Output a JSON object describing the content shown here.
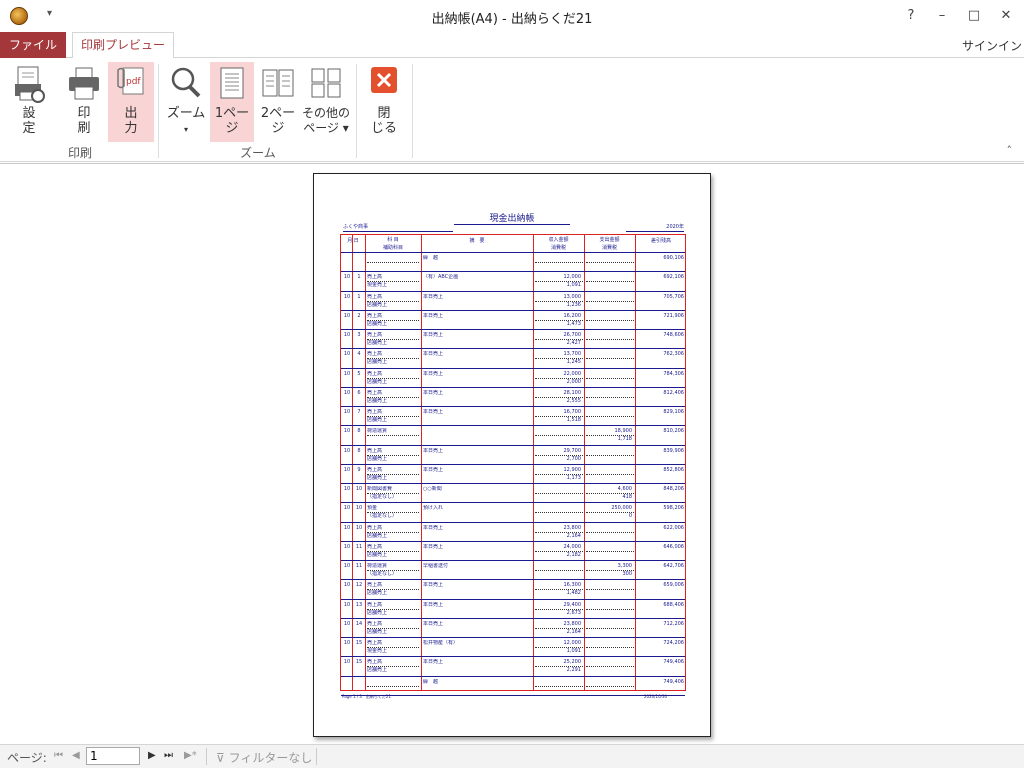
{
  "window": {
    "title": "出納帳(A4) - 出納らくだ21",
    "help": "?",
    "minimize": "–",
    "maximize": "□",
    "close": "✕",
    "qat": "▾"
  },
  "tabs": {
    "file": "ファイル",
    "print_preview": "印刷プレビュー",
    "signin": "サインイン"
  },
  "ribbon": {
    "settings": [
      "設",
      "定"
    ],
    "print": [
      "印",
      "刷"
    ],
    "output": [
      "出",
      "力"
    ],
    "zoom": [
      "ズーム",
      "▾"
    ],
    "one_page": [
      "1ペー",
      "ジ"
    ],
    "two_page": [
      "2ペー",
      "ジ"
    ],
    "other_pages": [
      "その他の",
      "ページ ▾"
    ],
    "close": [
      "閉",
      "じる"
    ],
    "group_print": "印刷",
    "group_zoom": "ズーム",
    "collapse": "˄",
    "accent": "#a4373a",
    "active_bg": "#f9d4d4"
  },
  "report": {
    "title": "現金出納帳",
    "company": "ふくや商事",
    "year": "2020年",
    "headers": {
      "date": "月 日",
      "account": "科 目",
      "sub_account": "補助科目",
      "description": "摘　要",
      "income": "収入金額",
      "income_tax": "消費税",
      "expense": "支出金額",
      "expense_tax": "消費税",
      "balance": "差引残高"
    },
    "rows": [
      {
        "m": "",
        "d": "",
        "a": "",
        "s": "",
        "desc": "繰　越",
        "inc": "",
        "inct": "",
        "exp": "",
        "expt": "",
        "bal": "690,106"
      },
      {
        "m": "10",
        "d": "1",
        "a": "売上高",
        "s": "現金売上",
        "desc": "（有）ABC企画",
        "inc": "12,000",
        "inct": "1,091",
        "exp": "",
        "expt": "",
        "bal": "692,106"
      },
      {
        "m": "10",
        "d": "1",
        "a": "売上高",
        "s": "店舗売上",
        "desc": "本日売上",
        "inc": "13,000",
        "inct": "1,236",
        "exp": "",
        "expt": "",
        "bal": "705,706"
      },
      {
        "m": "10",
        "d": "2",
        "a": "売上高",
        "s": "店舗売上",
        "desc": "本日売上",
        "inc": "16,200",
        "inct": "1,473",
        "exp": "",
        "expt": "",
        "bal": "721,906"
      },
      {
        "m": "10",
        "d": "3",
        "a": "売上高",
        "s": "店舗売上",
        "desc": "本日売上",
        "inc": "26,700",
        "inct": "2,427",
        "exp": "",
        "expt": "",
        "bal": "748,606"
      },
      {
        "m": "10",
        "d": "4",
        "a": "売上高",
        "s": "店舗売上",
        "desc": "本日売上",
        "inc": "13,700",
        "inct": "1,245",
        "exp": "",
        "expt": "",
        "bal": "762,306"
      },
      {
        "m": "10",
        "d": "5",
        "a": "売上高",
        "s": "店舗売上",
        "desc": "本日売上",
        "inc": "22,000",
        "inct": "2,000",
        "exp": "",
        "expt": "",
        "bal": "784,306"
      },
      {
        "m": "10",
        "d": "6",
        "a": "売上高",
        "s": "店舗売上",
        "desc": "本日売上",
        "inc": "28,100",
        "inct": "2,555",
        "exp": "",
        "expt": "",
        "bal": "812,406"
      },
      {
        "m": "10",
        "d": "7",
        "a": "売上高",
        "s": "店舗売上",
        "desc": "本日売上",
        "inc": "16,700",
        "inct": "1,518",
        "exp": "",
        "expt": "",
        "bal": "829,106"
      },
      {
        "m": "10",
        "d": "8",
        "a": "荷造運賃",
        "s": "",
        "desc": "",
        "inc": "",
        "inct": "",
        "exp": "18,900",
        "expt": "1,718",
        "bal": "810,206"
      },
      {
        "m": "10",
        "d": "8",
        "a": "売上高",
        "s": "店舗売上",
        "desc": "本日売上",
        "inc": "29,700",
        "inct": "2,700",
        "exp": "",
        "expt": "",
        "bal": "839,906"
      },
      {
        "m": "10",
        "d": "9",
        "a": "売上高",
        "s": "店舗売上",
        "desc": "本日売上",
        "inc": "12,900",
        "inct": "1,173",
        "exp": "",
        "expt": "",
        "bal": "852,806"
      },
      {
        "m": "10",
        "d": "10",
        "a": "新聞図書費",
        "s": "（指定なし）",
        "desc": "○○新聞",
        "inc": "",
        "inct": "",
        "exp": "4,600",
        "expt": "418",
        "bal": "848,206"
      },
      {
        "m": "10",
        "d": "10",
        "a": "預金",
        "s": "（指定なし）",
        "desc": "預け入れ",
        "inc": "",
        "inct": "",
        "exp": "250,000",
        "expt": "0",
        "bal": "598,206"
      },
      {
        "m": "10",
        "d": "10",
        "a": "売上高",
        "s": "店舗売上",
        "desc": "本日売上",
        "inc": "23,800",
        "inct": "2,164",
        "exp": "",
        "expt": "",
        "bal": "622,006"
      },
      {
        "m": "10",
        "d": "11",
        "a": "売上高",
        "s": "店舗売上",
        "desc": "本日売上",
        "inc": "24,000",
        "inct": "2,182",
        "exp": "",
        "expt": "",
        "bal": "646,006"
      },
      {
        "m": "10",
        "d": "11",
        "a": "荷造運賃",
        "s": "（指定なし）",
        "desc": "早稲書送付",
        "inc": "",
        "inct": "",
        "exp": "3,300",
        "expt": "300",
        "bal": "642,706"
      },
      {
        "m": "10",
        "d": "12",
        "a": "売上高",
        "s": "店舗売上",
        "desc": "本日売上",
        "inc": "16,300",
        "inct": "1,482",
        "exp": "",
        "expt": "",
        "bal": "659,006"
      },
      {
        "m": "10",
        "d": "13",
        "a": "売上高",
        "s": "店舗売上",
        "desc": "本日売上",
        "inc": "29,400",
        "inct": "2,673",
        "exp": "",
        "expt": "",
        "bal": "688,406"
      },
      {
        "m": "10",
        "d": "14",
        "a": "売上高",
        "s": "店舗売上",
        "desc": "本日売上",
        "inc": "23,800",
        "inct": "2,164",
        "exp": "",
        "expt": "",
        "bal": "712,206"
      },
      {
        "m": "10",
        "d": "15",
        "a": "売上高",
        "s": "現金売上",
        "desc": "松井物産（有）",
        "inc": "12,000",
        "inct": "1,091",
        "exp": "",
        "expt": "",
        "bal": "724,206"
      },
      {
        "m": "10",
        "d": "15",
        "a": "売上高",
        "s": "店舗売上",
        "desc": "本日売上",
        "inc": "25,200",
        "inct": "2,291",
        "exp": "",
        "expt": "",
        "bal": "749,406"
      },
      {
        "m": "",
        "d": "",
        "a": "",
        "s": "",
        "desc": "繰　越",
        "inc": "",
        "inct": "",
        "exp": "",
        "expt": "",
        "bal": "749,406"
      }
    ],
    "footer_left": "Page 1 / 3　出納らくだ21",
    "footer_right": "2020/10/30"
  },
  "statusbar": {
    "page_label": "ページ:",
    "first": "⏮",
    "prev": "◀",
    "current_page": "1",
    "next": "▶",
    "last": "⏭",
    "new": "▶*",
    "filter": "フィルターなし"
  }
}
